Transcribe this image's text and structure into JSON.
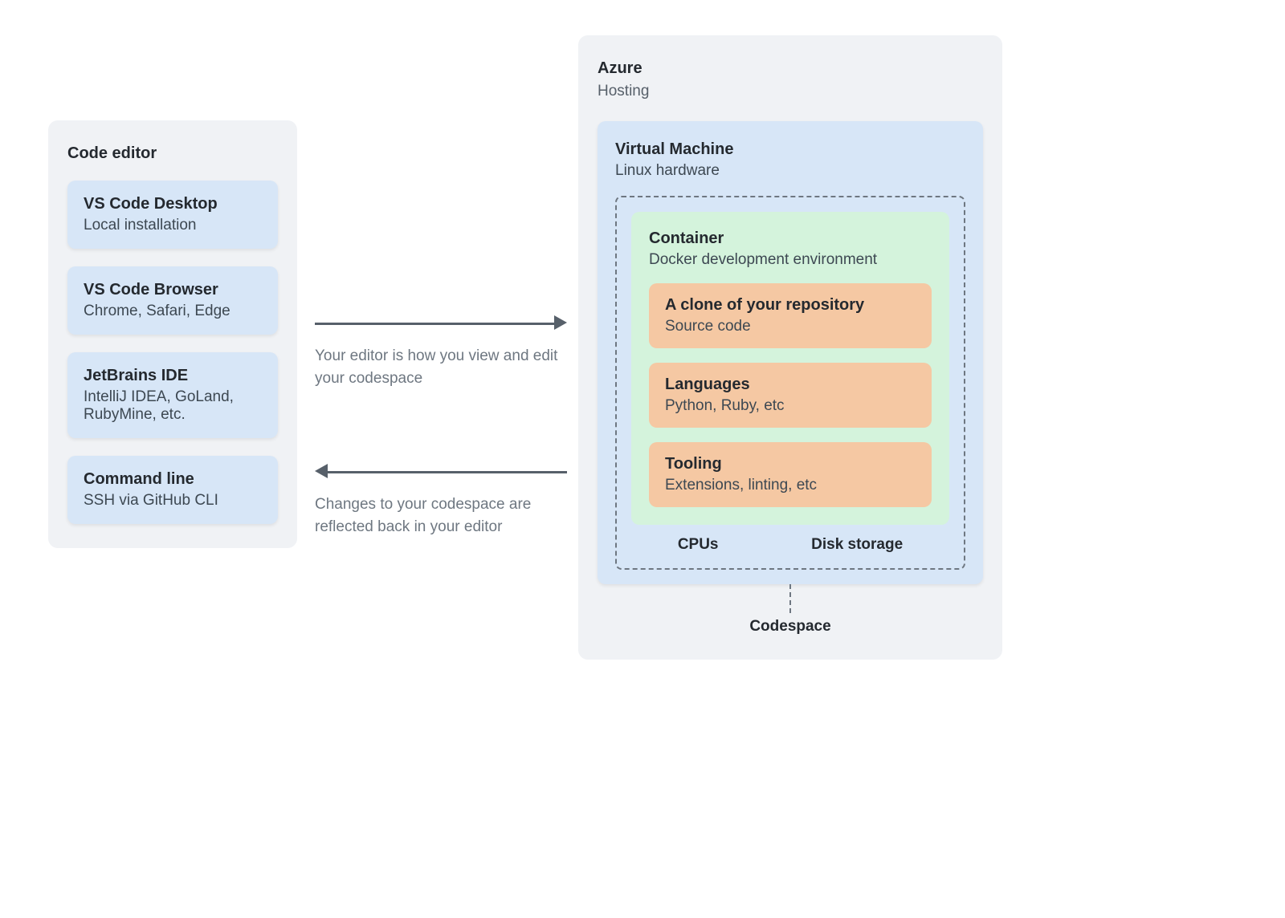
{
  "left": {
    "title": "Code editor",
    "editors": [
      {
        "title": "VS Code Desktop",
        "sub": "Local installation"
      },
      {
        "title": "VS Code Browser",
        "sub": "Chrome, Safari, Edge"
      },
      {
        "title": "JetBrains IDE",
        "sub": "IntelliJ IDEA, GoLand, RubyMine, etc."
      },
      {
        "title": "Command line",
        "sub": "SSH via GitHub CLI"
      }
    ]
  },
  "arrows": {
    "to_right": "Your editor is how you view and edit your codespace",
    "to_left": "Changes to your codespace are reflected back in your editor"
  },
  "right": {
    "azure_title": "Azure",
    "azure_sub": "Hosting",
    "vm_title": "Virtual Machine",
    "vm_sub": "Linux hardware",
    "container_title": "Container",
    "container_sub": "Docker development environment",
    "items": [
      {
        "title": "A clone of your repository",
        "sub": "Source code"
      },
      {
        "title": "Languages",
        "sub": "Python, Ruby, etc"
      },
      {
        "title": "Tooling",
        "sub": "Extensions, linting, etc"
      }
    ],
    "cpu_label": "CPUs",
    "disk_label": "Disk storage",
    "codespace_label": "Codespace"
  }
}
